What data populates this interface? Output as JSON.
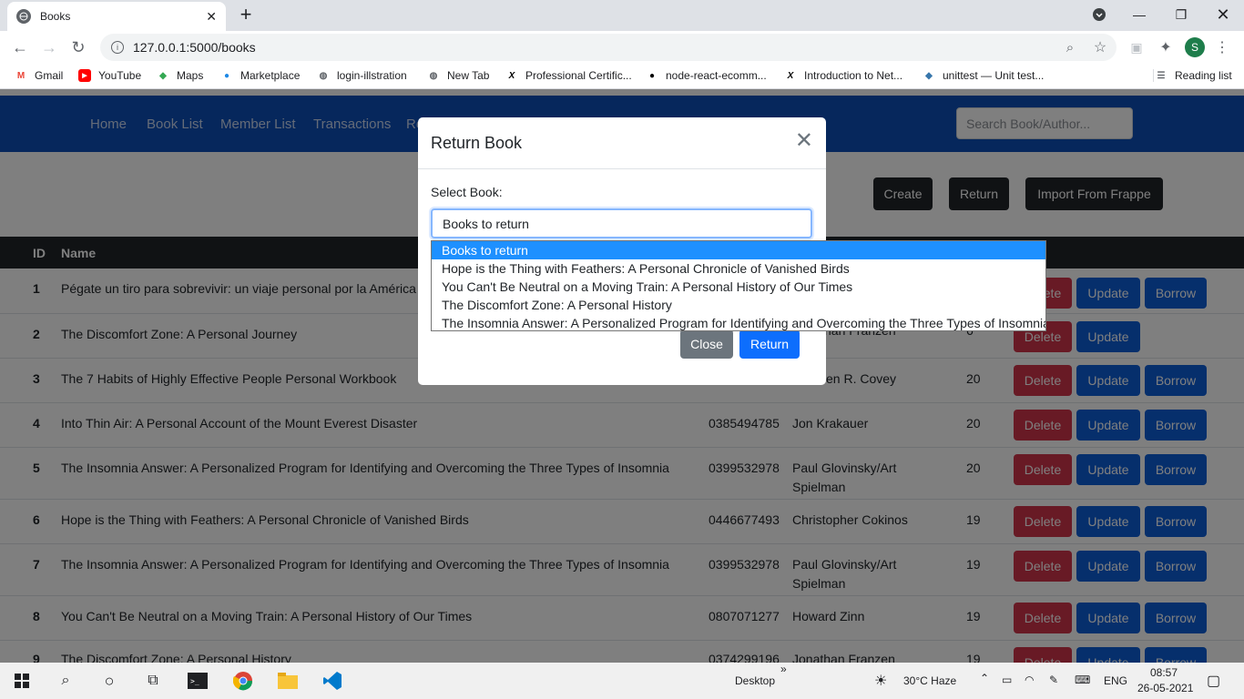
{
  "browser": {
    "tab_title": "Books",
    "url": "127.0.0.1:5000/books",
    "profile_initial": "S",
    "bookmarks": [
      "Gmail",
      "YouTube",
      "Maps",
      "Marketplace",
      "login-illstration",
      "New Tab",
      "Professional Certific...",
      "node-react-ecomm...",
      "Introduction to Net...",
      "unittest — Unit test..."
    ],
    "reading_list": "Reading list"
  },
  "nav": {
    "links": [
      "Home",
      "Book List",
      "Member List",
      "Transactions",
      "Re"
    ],
    "search_placeholder": "Search Book/Author..."
  },
  "actions": {
    "create": "Create",
    "return": "Return",
    "import": "Import From Frappe"
  },
  "table": {
    "headers": {
      "id": "ID",
      "name": "Name"
    },
    "rows": [
      {
        "id": "1",
        "name": "Pégate un tiro para sobrevivir: un viaje personal por la América",
        "isbn": "",
        "author": "",
        "qty": ""
      },
      {
        "id": "2",
        "name": "The Discomfort Zone: A Personal Journey",
        "isbn": "",
        "author": "",
        "qty": ""
      },
      {
        "id": "3",
        "name": "The 7 Habits of Highly Effective People Personal Workbook",
        "isbn": "",
        "author": "en R. Covey",
        "qty": "20"
      },
      {
        "id": "4",
        "name": "Into Thin Air: A Personal Account of the Mount Everest Disaster",
        "isbn": "0385494785",
        "author": "Jon Krakauer",
        "qty": "20"
      },
      {
        "id": "5",
        "name": "The Insomnia Answer: A Personalized Program for Identifying and Overcoming the Three Types of Insomnia",
        "isbn": "0399532978",
        "author": "Paul Glovinsky/Art Spielman",
        "qty": "20"
      },
      {
        "id": "6",
        "name": "Hope is the Thing with Feathers: A Personal Chronicle of Vanished Birds",
        "isbn": "0446677493",
        "author": "Christopher Cokinos",
        "qty": "19"
      },
      {
        "id": "7",
        "name": "The Insomnia Answer: A Personalized Program for Identifying and Overcoming the Three Types of Insomnia",
        "isbn": "0399532978",
        "author": "Paul Glovinsky/Art Spielman",
        "qty": "19"
      },
      {
        "id": "8",
        "name": "You Can't Be Neutral on a Moving Train: A Personal History of Our Times",
        "isbn": "0807071277",
        "author": "Howard Zinn",
        "qty": "19"
      },
      {
        "id": "9",
        "name": "The Discomfort Zone: A Personal History",
        "isbn": "0374299196",
        "author": "Jonathan Franzen",
        "qty": "19"
      }
    ],
    "row2_author_partial": "han Franzen",
    "row2_qty_partial": "6",
    "btn_delete": "Delete",
    "btn_update": "Update",
    "btn_borrow": "Borrow"
  },
  "modal": {
    "title": "Return Book",
    "select_label": "Select Book:",
    "selected_value": "Books to return",
    "options": [
      "Books to return",
      "Hope is the Thing with Feathers: A Personal Chronicle of Vanished Birds",
      "You Can't Be Neutral on a Moving Train: A Personal History of Our Times",
      "The Discomfort Zone: A Personal History",
      "The Insomnia Answer: A Personalized Program for Identifying and Overcoming the Three Types of Insomnia"
    ],
    "close_label": "Close",
    "return_label": "Return"
  },
  "taskbar": {
    "desktop": "Desktop",
    "weather": "30°C  Haze",
    "lang": "ENG",
    "time": "08:57",
    "date": "26-05-2021"
  },
  "colors": {
    "navbar": "#0c4fb8",
    "danger": "#d1344b",
    "primary": "#0d5ed9",
    "dark": "#212529",
    "secondary": "#6c757d"
  }
}
